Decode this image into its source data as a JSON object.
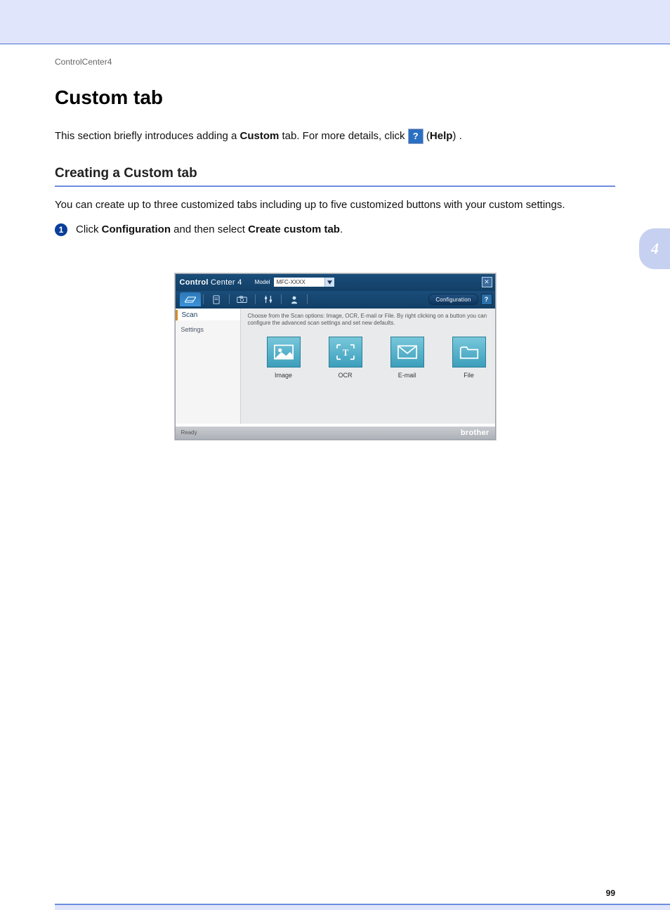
{
  "page": {
    "breadcrumb": "ControlCenter4",
    "chapter_number": "4",
    "page_number": "99",
    "h1": "Custom tab",
    "intro_before": "This section briefly introduces adding a ",
    "intro_bold": "Custom",
    "intro_mid": " tab. For more details, click ",
    "intro_help_glyph": "?",
    "intro_after_open": " (",
    "intro_help_word": "Help",
    "intro_after_close": ") .",
    "h2": "Creating a Custom tab",
    "p_maxinfo": "You can create up to three customized tabs including up to five customized buttons with your custom settings.",
    "step1_num": "1",
    "step1_a": "Click ",
    "step1_b": "Configuration",
    "step1_c": " and then select ",
    "step1_d": "Create custom tab",
    "step1_e": "."
  },
  "cc": {
    "logo_bold": "Control",
    "logo_rest": " Center 4",
    "model_label": "Model",
    "model_value": "MFC-XXXX",
    "config_button": "Configuration",
    "help_glyph": "?",
    "close_glyph": "✕",
    "sidebar": {
      "scan": "Scan",
      "settings": "Settings"
    },
    "description": "Choose from the Scan options: Image, OCR, E-mail or File. By right clicking on a button you can configure the advanced scan settings and set new defaults.",
    "tiles": [
      {
        "label": "Image"
      },
      {
        "label": "OCR"
      },
      {
        "label": "E-mail"
      },
      {
        "label": "File"
      }
    ],
    "status": "Ready",
    "brand": "brother"
  }
}
